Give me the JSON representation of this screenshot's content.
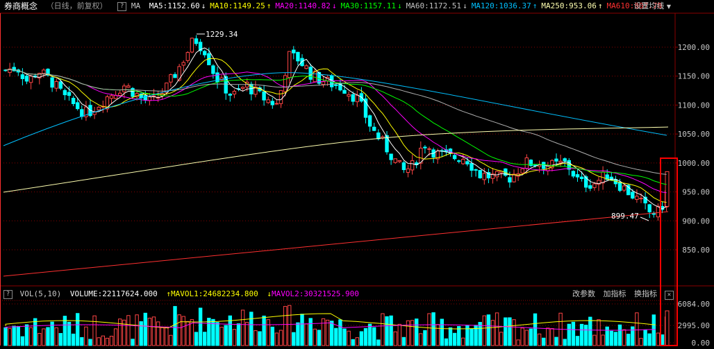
{
  "header": {
    "title": "券商概念",
    "mode": "（日线，前复权）",
    "help_icon": "?",
    "ma_label": "MA",
    "ma_items": [
      {
        "text": "MA5:1152.60",
        "arrow": "↓",
        "color": "#ffffff",
        "arrow_color": "#ffffff"
      },
      {
        "text": "MA10:1149.25",
        "arrow": "↑",
        "color": "#ffff00",
        "arrow_color": "#ffff00"
      },
      {
        "text": "MA20:1140.82",
        "arrow": "↓",
        "color": "#ff00ff",
        "arrow_color": "#ff00ff"
      },
      {
        "text": "MA30:1157.11",
        "arrow": "↓",
        "color": "#00ff00",
        "arrow_color": "#00ff00"
      },
      {
        "text": "MA60:1172.51",
        "arrow": "↓",
        "color": "#c0c0c0",
        "arrow_color": "#c0c0c0"
      },
      {
        "text": "MA120:1036.37",
        "arrow": "↑",
        "color": "#00c0ff",
        "arrow_color": "#00c0ff"
      },
      {
        "text": "MA250:953.06",
        "arrow": "↑",
        "color": "#ffffb0",
        "arrow_color": "#ffffb0"
      },
      {
        "text": "MA610:807.70",
        "arrow": "",
        "color": "#ff3030",
        "arrow_color": "#ff3030"
      }
    ],
    "settings_label": "设置均线",
    "settings_arrow": "▼"
  },
  "price_axis": [
    "1200.00",
    "1150.00",
    "1100.00",
    "1050.00",
    "1000.00",
    "950.00",
    "900.00",
    "850.00"
  ],
  "annotations": {
    "high": "1229.34",
    "low": "899.47"
  },
  "volume_header": {
    "help_icon": "?",
    "label": "VOL(5,10)",
    "volume": "VOLUME:22117624.000",
    "mavol1": "MAVOL1:24682234.800",
    "mavol1_arrow": "↑",
    "mavol2": "MAVOL2:30321525.900",
    "mavol2_arrow": "↓",
    "menu": [
      "改参数",
      "加指标",
      "换指标"
    ],
    "close": "✕"
  },
  "volume_axis": [
    "6084.00",
    "2995.00",
    "0.00"
  ],
  "colors": {
    "up": "#ff4545",
    "down": "#00ffff",
    "grid": "#8a0000",
    "highlight": "#ff0000"
  }
}
